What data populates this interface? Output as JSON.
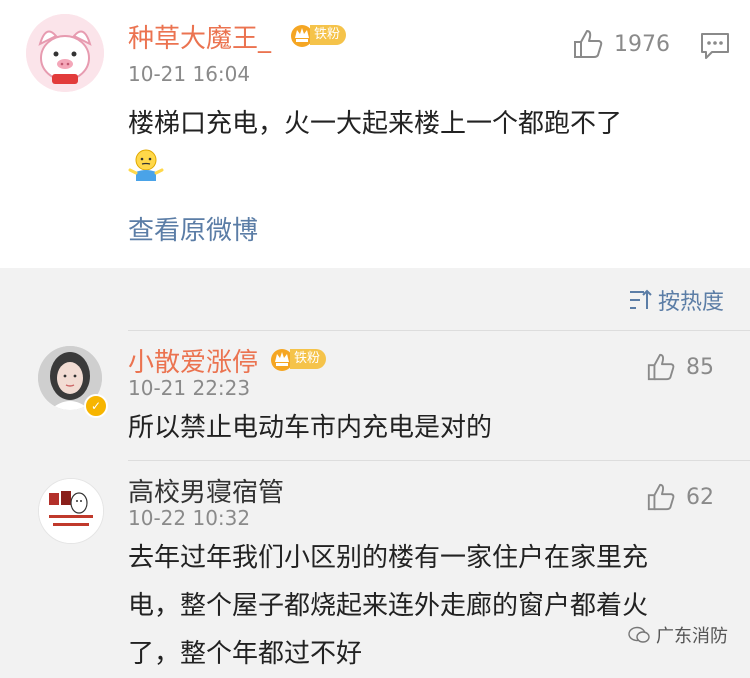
{
  "main_comment": {
    "username": "种草大魔王_",
    "badge": "铁粉",
    "time": "10-21 16:04",
    "likes": "1976",
    "text": "楼梯口充电，火一大起来楼上一个都跑不了",
    "emoji_icon": "shrug-emoji-icon",
    "view_original": "查看原微博"
  },
  "sort": {
    "label": "按热度"
  },
  "comments": [
    {
      "username": "小散爱涨停",
      "badge": "铁粉",
      "time": "10-21 22:23",
      "likes": "85",
      "text": "所以禁止电动车市内充电是对的"
    },
    {
      "username": "高校男寝宿管",
      "time": "10-22 10:32",
      "likes": "62",
      "text_lines": [
        "去年过年我们小区别的楼有一家住户在家里充",
        "电，整个屋子都烧起来连外走廊的窗户都着火",
        "了，整个年都过不好"
      ]
    }
  ],
  "watermark": "广东消防",
  "colors": {
    "username_orange": "#eb7350",
    "link_blue": "#5b7da6",
    "badge_gold": "#f5c34a"
  }
}
